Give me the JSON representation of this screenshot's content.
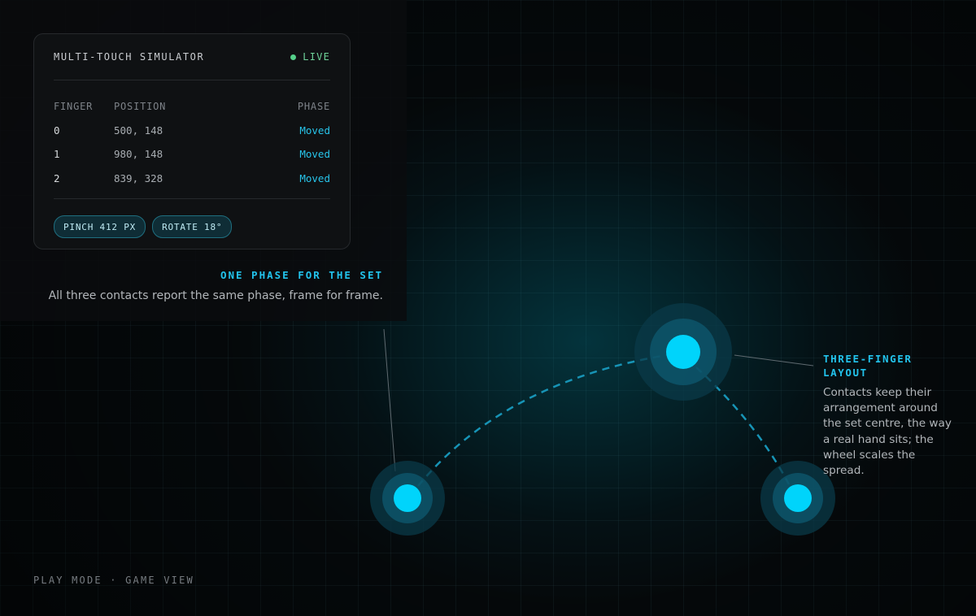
{
  "panel": {
    "title": "MULTI-TOUCH SIMULATOR",
    "status": "LIVE",
    "columns": [
      "FINGER",
      "POSITION",
      "PHASE"
    ],
    "rows": [
      {
        "finger": "0",
        "position": "500, 148",
        "phase": "Moved"
      },
      {
        "finger": "1",
        "position": "980, 148",
        "phase": "Moved"
      },
      {
        "finger": "2",
        "position": "839, 328",
        "phase": "Moved"
      }
    ],
    "chips": [
      "PINCH 412 PX",
      "ROTATE 18°"
    ]
  },
  "callouts": {
    "phase": {
      "title": "ONE PHASE FOR THE SET",
      "body": "All three contacts report the same phase, frame for frame."
    },
    "layout": {
      "title": "THREE-FINGER LAYOUT",
      "body": "Contacts keep their arrangement around the set centre, the way a real hand sits; the wheel scales the spread."
    }
  },
  "footer": "PLAY MODE · GAME VIEW",
  "colors": {
    "accent": "#00d8ff",
    "live": "#55d08a",
    "background": "#06090b"
  }
}
